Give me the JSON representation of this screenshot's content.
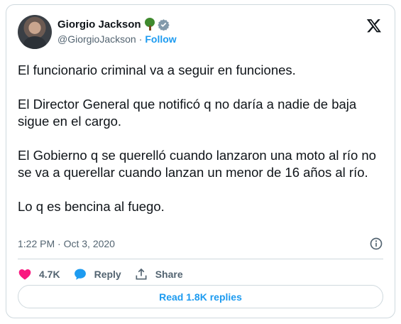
{
  "author": {
    "display_name": "Giorgio Jackson",
    "handle": "@GiorgioJackson",
    "follow_label": "Follow",
    "emoji_icon": "tree-icon",
    "verified_color": "#829aab"
  },
  "tweet": {
    "paragraphs": [
      "El funcionario criminal va a seguir en funciones.",
      "El Director General que notificó q no daría a nadie de baja sigue en el cargo.",
      "El Gobierno q se querelló cuando lanzaron una moto al río no se va a querellar cuando lanzan un menor de 16 años al río.",
      "Lo q es bencina al fuego."
    ],
    "timestamp": "1:22 PM · Oct 3, 2020"
  },
  "actions": {
    "likes": "4.7K",
    "reply_label": "Reply",
    "share_label": "Share"
  },
  "read_replies_label": "Read 1.8K replies",
  "colors": {
    "accent": "#1d9bf0",
    "like": "#f91880",
    "text_secondary": "#536471",
    "border": "#cfd9de"
  }
}
